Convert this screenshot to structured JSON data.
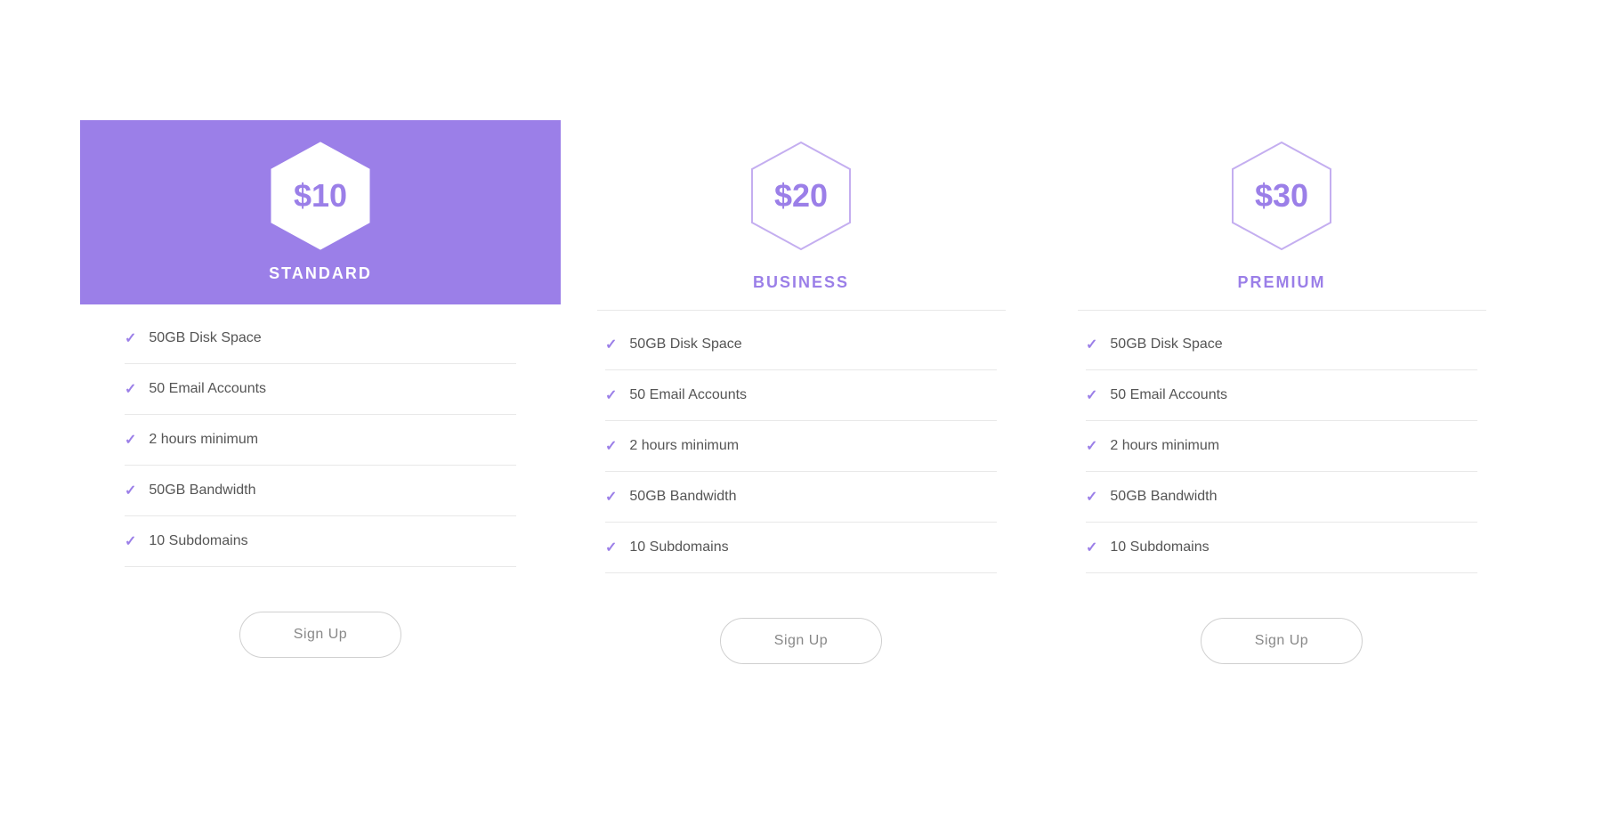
{
  "plans": [
    {
      "id": "standard",
      "price": "$10",
      "name": "STANDARD",
      "active": true,
      "features": [
        "50GB Disk Space",
        "50 Email Accounts",
        "2 hours minimum",
        "50GB Bandwidth",
        "10 Subdomains"
      ],
      "signup_label": "Sign Up"
    },
    {
      "id": "business",
      "price": "$20",
      "name": "BUSINESS",
      "active": false,
      "features": [
        "50GB Disk Space",
        "50 Email Accounts",
        "2 hours minimum",
        "50GB Bandwidth",
        "10 Subdomains"
      ],
      "signup_label": "Sign Up"
    },
    {
      "id": "premium",
      "price": "$30",
      "name": "PREMIUM",
      "active": false,
      "features": [
        "50GB Disk Space",
        "50 Email Accounts",
        "2 hours minimum",
        "50GB Bandwidth",
        "10 Subdomains"
      ],
      "signup_label": "Sign Up"
    }
  ],
  "check_symbol": "✓"
}
